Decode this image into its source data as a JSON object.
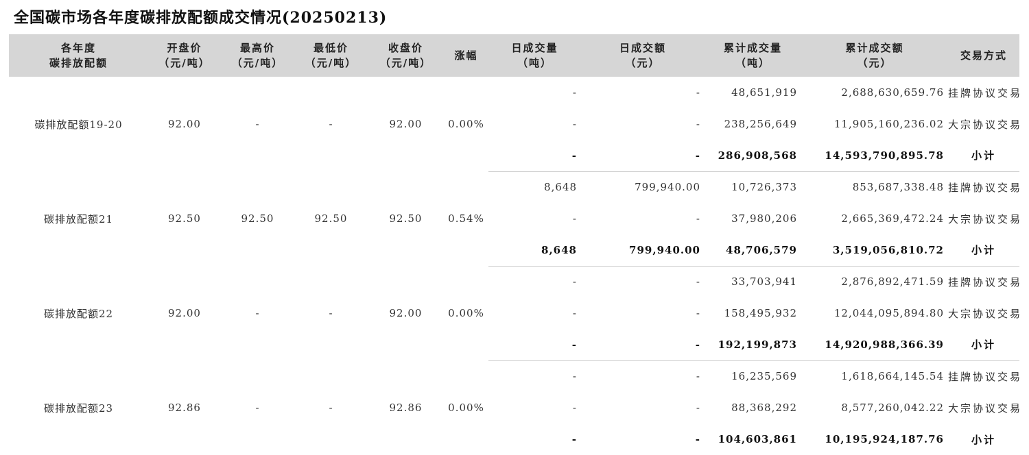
{
  "title": "全国碳市场各年度碳排放配额成交情况(20250213)",
  "headers": [
    "各年度\n碳排放配额",
    "开盘价\n（元/吨）",
    "最高价\n（元/吨）",
    "最低价\n（元/吨）",
    "收盘价\n（元/吨）",
    "涨幅",
    "日成交量\n（吨）",
    "日成交额\n（元）",
    "累计成交量\n（吨）",
    "累计成交额\n（元）",
    "交易方式"
  ],
  "groups": [
    {
      "name": "碳排放配额19-20",
      "open": "92.00",
      "high": "-",
      "low": "-",
      "close": "92.00",
      "change": "0.00%",
      "rows": [
        {
          "day_volume": "-",
          "day_amount": "-",
          "cum_volume": "48,651,919",
          "cum_amount": "2,688,630,659.76",
          "method": "挂牌协议交易"
        },
        {
          "day_volume": "-",
          "day_amount": "-",
          "cum_volume": "238,256,649",
          "cum_amount": "11,905,160,236.02",
          "method": "大宗协议交易"
        },
        {
          "day_volume": "-",
          "day_amount": "-",
          "cum_volume": "286,908,568",
          "cum_amount": "14,593,790,895.78",
          "method": "小计"
        }
      ]
    },
    {
      "name": "碳排放配额21",
      "open": "92.50",
      "high": "92.50",
      "low": "92.50",
      "close": "92.50",
      "change": "0.54%",
      "rows": [
        {
          "day_volume": "8,648",
          "day_amount": "799,940.00",
          "cum_volume": "10,726,373",
          "cum_amount": "853,687,338.48",
          "method": "挂牌协议交易"
        },
        {
          "day_volume": "-",
          "day_amount": "-",
          "cum_volume": "37,980,206",
          "cum_amount": "2,665,369,472.24",
          "method": "大宗协议交易"
        },
        {
          "day_volume": "8,648",
          "day_amount": "799,940.00",
          "cum_volume": "48,706,579",
          "cum_amount": "3,519,056,810.72",
          "method": "小计"
        }
      ]
    },
    {
      "name": "碳排放配额22",
      "open": "92.00",
      "high": "-",
      "low": "-",
      "close": "92.00",
      "change": "0.00%",
      "rows": [
        {
          "day_volume": "-",
          "day_amount": "-",
          "cum_volume": "33,703,941",
          "cum_amount": "2,876,892,471.59",
          "method": "挂牌协议交易"
        },
        {
          "day_volume": "-",
          "day_amount": "-",
          "cum_volume": "158,495,932",
          "cum_amount": "12,044,095,894.80",
          "method": "大宗协议交易"
        },
        {
          "day_volume": "-",
          "day_amount": "-",
          "cum_volume": "192,199,873",
          "cum_amount": "14,920,988,366.39",
          "method": "小计"
        }
      ]
    },
    {
      "name": "碳排放配额23",
      "open": "92.86",
      "high": "-",
      "low": "-",
      "close": "92.86",
      "change": "0.00%",
      "rows": [
        {
          "day_volume": "-",
          "day_amount": "-",
          "cum_volume": "16,235,569",
          "cum_amount": "1,618,664,145.54",
          "method": "挂牌协议交易"
        },
        {
          "day_volume": "-",
          "day_amount": "-",
          "cum_volume": "88,368,292",
          "cum_amount": "8,577,260,042.22",
          "method": "大宗协议交易"
        },
        {
          "day_volume": "-",
          "day_amount": "-",
          "cum_volume": "104,603,861",
          "cum_amount": "10,195,924,187.76",
          "method": "小计"
        }
      ]
    }
  ]
}
